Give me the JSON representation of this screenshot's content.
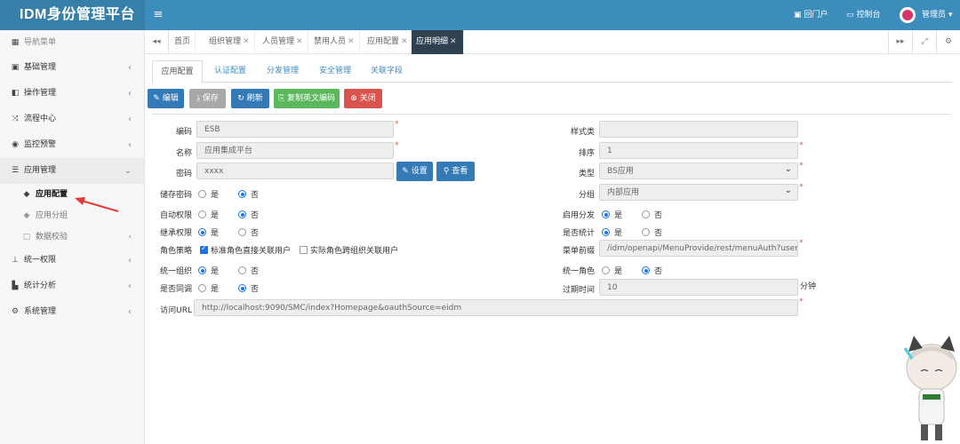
{
  "app": {
    "title": "IDM身份管理平台",
    "menu_toggle": "≡"
  },
  "header": {
    "portal_label": "回门户",
    "console_label": "控制台",
    "user_label": "管理员"
  },
  "sidebar": {
    "title": "导航菜单",
    "items": [
      {
        "label": "基础管理",
        "icon": "id-card-icon"
      },
      {
        "label": "操作管理",
        "icon": "book-icon"
      },
      {
        "label": "流程中心",
        "icon": "shuffle-icon"
      },
      {
        "label": "监控预警",
        "icon": "eye-icon"
      },
      {
        "label": "应用管理",
        "icon": "list-icon"
      }
    ],
    "subitems": [
      {
        "label": "应用配置",
        "active": true
      },
      {
        "label": "应用分组"
      },
      {
        "label": "数据校验"
      }
    ],
    "items_after": [
      {
        "label": "统一权限",
        "icon": "sitemap-icon"
      },
      {
        "label": "统计分析",
        "icon": "bar-chart-icon"
      },
      {
        "label": "系统管理",
        "icon": "cogs-icon"
      }
    ]
  },
  "tabs": [
    {
      "label": "首页",
      "closable": false
    },
    {
      "label": "组织管理",
      "closable": true
    },
    {
      "label": "人员管理",
      "closable": true
    },
    {
      "label": "禁用人员",
      "closable": true
    },
    {
      "label": "应用配置",
      "closable": true
    },
    {
      "label": "应用明细",
      "closable": true,
      "active": true
    }
  ],
  "subtabs": [
    "应用配置",
    "认证配置",
    "分发管理",
    "安全管理",
    "关联字段"
  ],
  "toolbar": {
    "edit": "编辑",
    "save": "保存",
    "refresh": "刷新",
    "copy": "复制英文编码",
    "close": "关闭"
  },
  "form": {
    "code_label": "编码",
    "code_value": "ESB",
    "name_label": "名称",
    "name_value": "应用集成平台",
    "secret_label": "密码",
    "secret_value": "xxxx",
    "set_btn": "设置",
    "view_btn": "查看",
    "style_label": "样式类",
    "style_value": "",
    "sort_label": "排序",
    "sort_value": "1",
    "type_label": "类型",
    "type_value": "BS应用",
    "group_label": "分组",
    "group_value": "内部应用",
    "store_pwd_label": "储存密码",
    "auto_perm_label": "自动权限",
    "inherit_perm_label": "继承权限",
    "role_policy_label": "角色策略",
    "role_opt1": "标准角色直接关联用户",
    "role_opt2": "实际角色跨组织关联用户",
    "unified_org_label": "统一组织",
    "sync_label": "是否同调",
    "enable_dist_label": "启用分发",
    "stat_label": "是否统计",
    "menu_api_label": "菜单前缀",
    "menu_api_value": "/idm/openapi/MenuProvide/rest/menuAuth?user",
    "unified_role_label": "统一角色",
    "expire_label": "过期时间",
    "expire_value": "10",
    "expire_unit": "分钟",
    "url_label": "访问URL",
    "url_value": "http://localhost:9090/SMC/index?Homepage&oauthSource=eidm",
    "yes": "是",
    "no": "否",
    "required_mark": "*"
  }
}
